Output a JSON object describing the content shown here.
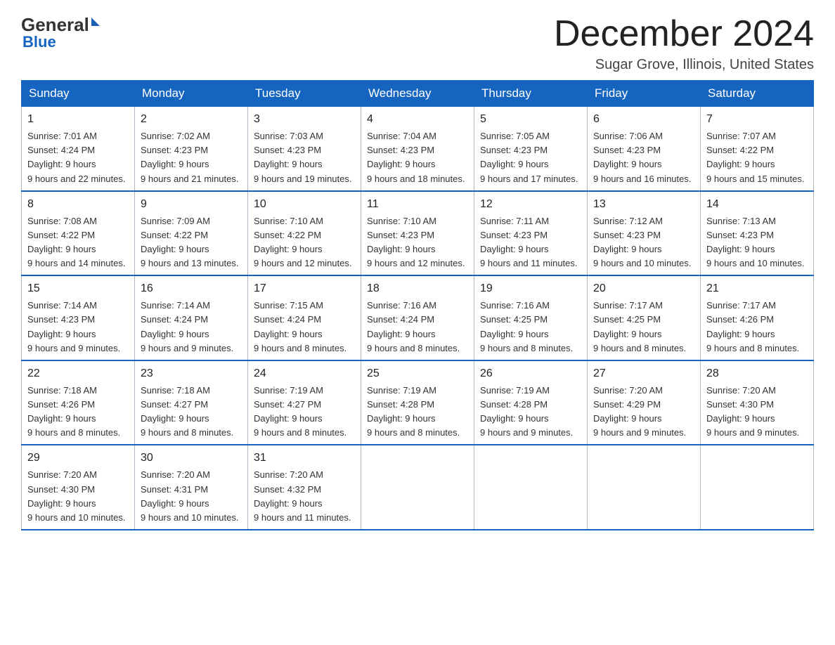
{
  "logo": {
    "general": "General",
    "blue": "Blue",
    "triangle_alt": "logo triangle"
  },
  "title": "December 2024",
  "location": "Sugar Grove, Illinois, United States",
  "weekdays": [
    "Sunday",
    "Monday",
    "Tuesday",
    "Wednesday",
    "Thursday",
    "Friday",
    "Saturday"
  ],
  "weeks": [
    [
      {
        "day": "1",
        "sunrise": "7:01 AM",
        "sunset": "4:24 PM",
        "daylight": "9 hours and 22 minutes."
      },
      {
        "day": "2",
        "sunrise": "7:02 AM",
        "sunset": "4:23 PM",
        "daylight": "9 hours and 21 minutes."
      },
      {
        "day": "3",
        "sunrise": "7:03 AM",
        "sunset": "4:23 PM",
        "daylight": "9 hours and 19 minutes."
      },
      {
        "day": "4",
        "sunrise": "7:04 AM",
        "sunset": "4:23 PM",
        "daylight": "9 hours and 18 minutes."
      },
      {
        "day": "5",
        "sunrise": "7:05 AM",
        "sunset": "4:23 PM",
        "daylight": "9 hours and 17 minutes."
      },
      {
        "day": "6",
        "sunrise": "7:06 AM",
        "sunset": "4:23 PM",
        "daylight": "9 hours and 16 minutes."
      },
      {
        "day": "7",
        "sunrise": "7:07 AM",
        "sunset": "4:22 PM",
        "daylight": "9 hours and 15 minutes."
      }
    ],
    [
      {
        "day": "8",
        "sunrise": "7:08 AM",
        "sunset": "4:22 PM",
        "daylight": "9 hours and 14 minutes."
      },
      {
        "day": "9",
        "sunrise": "7:09 AM",
        "sunset": "4:22 PM",
        "daylight": "9 hours and 13 minutes."
      },
      {
        "day": "10",
        "sunrise": "7:10 AM",
        "sunset": "4:22 PM",
        "daylight": "9 hours and 12 minutes."
      },
      {
        "day": "11",
        "sunrise": "7:10 AM",
        "sunset": "4:23 PM",
        "daylight": "9 hours and 12 minutes."
      },
      {
        "day": "12",
        "sunrise": "7:11 AM",
        "sunset": "4:23 PM",
        "daylight": "9 hours and 11 minutes."
      },
      {
        "day": "13",
        "sunrise": "7:12 AM",
        "sunset": "4:23 PM",
        "daylight": "9 hours and 10 minutes."
      },
      {
        "day": "14",
        "sunrise": "7:13 AM",
        "sunset": "4:23 PM",
        "daylight": "9 hours and 10 minutes."
      }
    ],
    [
      {
        "day": "15",
        "sunrise": "7:14 AM",
        "sunset": "4:23 PM",
        "daylight": "9 hours and 9 minutes."
      },
      {
        "day": "16",
        "sunrise": "7:14 AM",
        "sunset": "4:24 PM",
        "daylight": "9 hours and 9 minutes."
      },
      {
        "day": "17",
        "sunrise": "7:15 AM",
        "sunset": "4:24 PM",
        "daylight": "9 hours and 8 minutes."
      },
      {
        "day": "18",
        "sunrise": "7:16 AM",
        "sunset": "4:24 PM",
        "daylight": "9 hours and 8 minutes."
      },
      {
        "day": "19",
        "sunrise": "7:16 AM",
        "sunset": "4:25 PM",
        "daylight": "9 hours and 8 minutes."
      },
      {
        "day": "20",
        "sunrise": "7:17 AM",
        "sunset": "4:25 PM",
        "daylight": "9 hours and 8 minutes."
      },
      {
        "day": "21",
        "sunrise": "7:17 AM",
        "sunset": "4:26 PM",
        "daylight": "9 hours and 8 minutes."
      }
    ],
    [
      {
        "day": "22",
        "sunrise": "7:18 AM",
        "sunset": "4:26 PM",
        "daylight": "9 hours and 8 minutes."
      },
      {
        "day": "23",
        "sunrise": "7:18 AM",
        "sunset": "4:27 PM",
        "daylight": "9 hours and 8 minutes."
      },
      {
        "day": "24",
        "sunrise": "7:19 AM",
        "sunset": "4:27 PM",
        "daylight": "9 hours and 8 minutes."
      },
      {
        "day": "25",
        "sunrise": "7:19 AM",
        "sunset": "4:28 PM",
        "daylight": "9 hours and 8 minutes."
      },
      {
        "day": "26",
        "sunrise": "7:19 AM",
        "sunset": "4:28 PM",
        "daylight": "9 hours and 9 minutes."
      },
      {
        "day": "27",
        "sunrise": "7:20 AM",
        "sunset": "4:29 PM",
        "daylight": "9 hours and 9 minutes."
      },
      {
        "day": "28",
        "sunrise": "7:20 AM",
        "sunset": "4:30 PM",
        "daylight": "9 hours and 9 minutes."
      }
    ],
    [
      {
        "day": "29",
        "sunrise": "7:20 AM",
        "sunset": "4:30 PM",
        "daylight": "9 hours and 10 minutes."
      },
      {
        "day": "30",
        "sunrise": "7:20 AM",
        "sunset": "4:31 PM",
        "daylight": "9 hours and 10 minutes."
      },
      {
        "day": "31",
        "sunrise": "7:20 AM",
        "sunset": "4:32 PM",
        "daylight": "9 hours and 11 minutes."
      },
      null,
      null,
      null,
      null
    ]
  ]
}
